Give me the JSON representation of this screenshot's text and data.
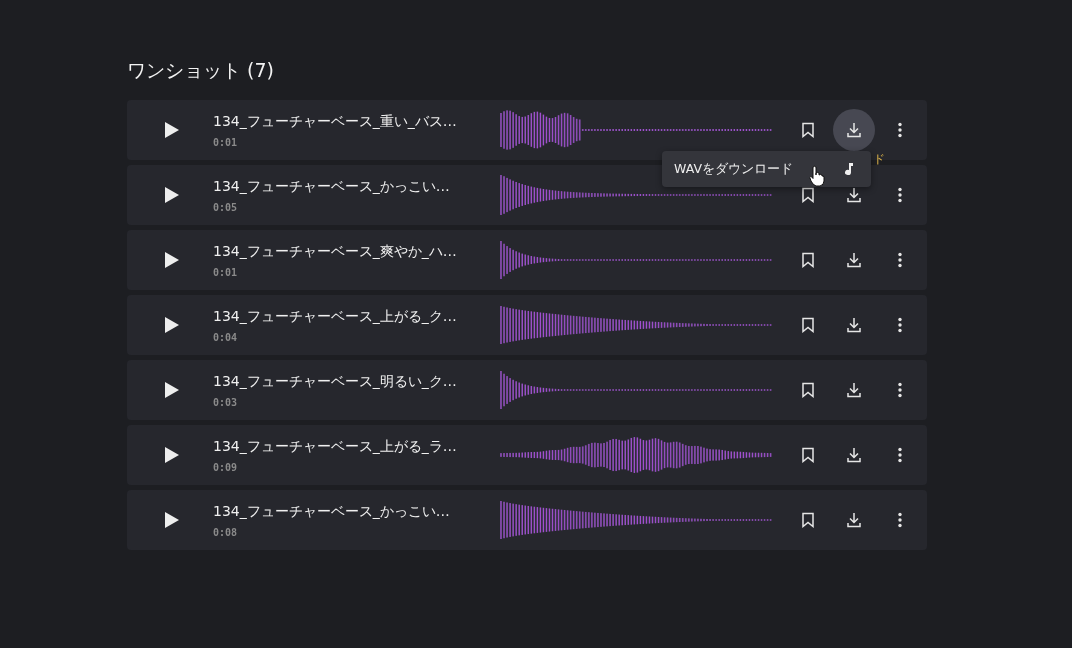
{
  "heading": "ワンショット (7)",
  "rows": [
    {
      "title": "134_フューチャーベース_重い_バス…",
      "time": "0:01",
      "waveform": {
        "kind": "burst"
      },
      "download_hovered": true
    },
    {
      "title": "134_フューチャーベース_かっこい…",
      "time": "0:05",
      "waveform": {
        "kind": "decay"
      },
      "download_hovered": false
    },
    {
      "title": "134_フューチャーベース_爽やか_ハ…",
      "time": "0:01",
      "waveform": {
        "kind": "sharp"
      },
      "download_hovered": false
    },
    {
      "title": "134_フューチャーベース_上がる_ク…",
      "time": "0:04",
      "waveform": {
        "kind": "long"
      },
      "download_hovered": false
    },
    {
      "title": "134_フューチャーベース_明るい_ク…",
      "time": "0:03",
      "waveform": {
        "kind": "sharp"
      },
      "download_hovered": false
    },
    {
      "title": "134_フューチャーベース_上がる_ラ…",
      "time": "0:09",
      "waveform": {
        "kind": "swell"
      },
      "download_hovered": false
    },
    {
      "title": "134_フューチャーベース_かっこい…",
      "time": "0:08",
      "waveform": {
        "kind": "long"
      },
      "download_hovered": false
    }
  ],
  "tooltip": "ド",
  "menu": {
    "label": "WAVをダウンロード"
  }
}
